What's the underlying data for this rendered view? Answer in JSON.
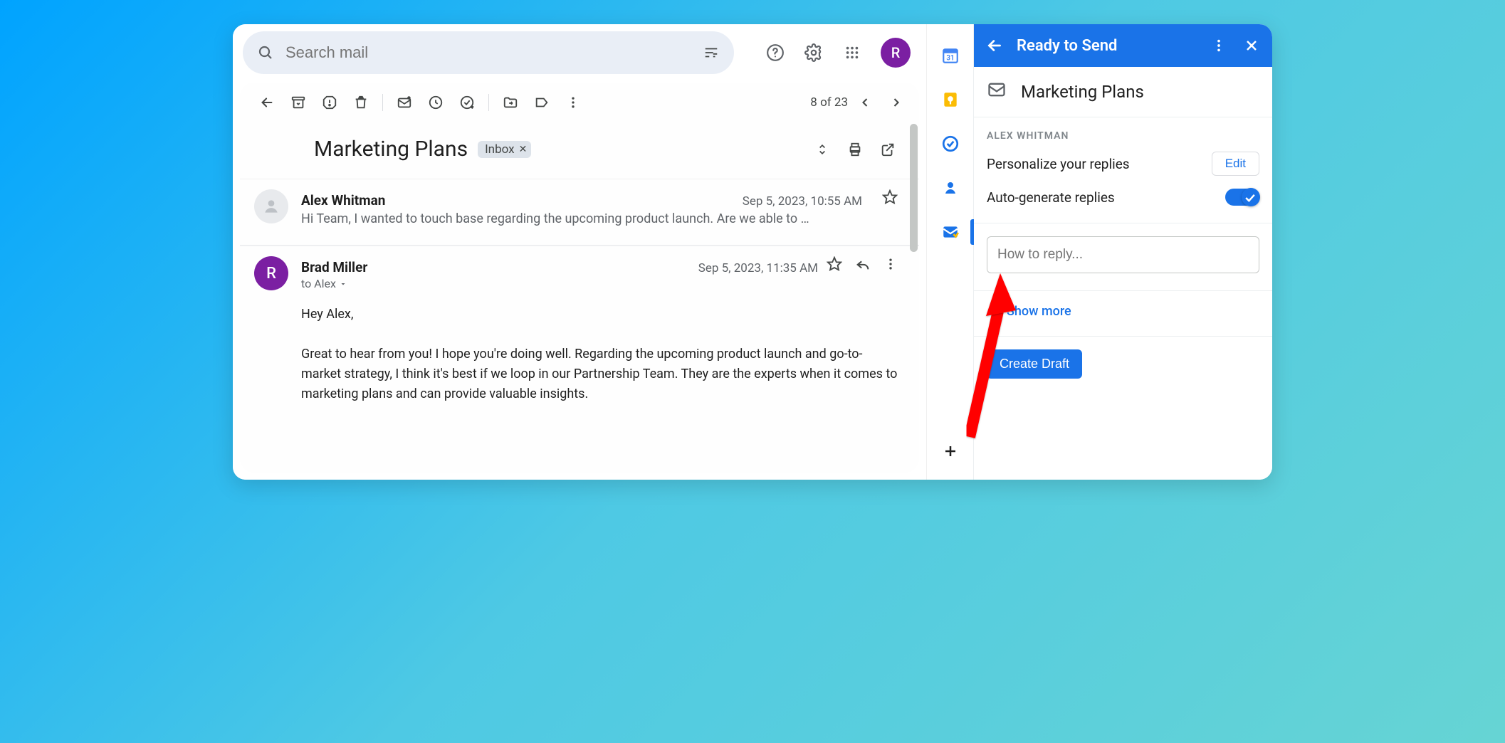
{
  "search": {
    "placeholder": "Search mail"
  },
  "avatar_letter": "R",
  "pager": {
    "label": "8 of 23"
  },
  "subject": "Marketing Plans",
  "subject_chip": "Inbox",
  "messages": {
    "collapsed": {
      "sender": "Alex Whitman",
      "date": "Sep 5, 2023, 10:55 AM",
      "snippet": "Hi Team, I wanted to touch base regarding the upcoming product launch. Are we able to …"
    },
    "expanded": {
      "sender": "Brad Miller",
      "avatar_letter": "R",
      "to_line": "to Alex",
      "date": "Sep 5, 2023, 11:35 AM",
      "greeting": "Hey Alex,",
      "body": "Great to hear from you! I hope you're doing well. Regarding the upcoming product launch and go-to-market strategy, I think it's best if we loop in our Partnership Team. They are the experts when it comes to marketing plans and can provide valuable insights."
    }
  },
  "panel": {
    "title": "Ready to Send",
    "subject": "Marketing Plans",
    "caption": "ALEX WHITMAN",
    "personalize_label": "Personalize your replies",
    "edit_label": "Edit",
    "autogen_label": "Auto-generate replies",
    "reply_placeholder": "How to reply...",
    "show_more": "Show more",
    "create_draft": "Create Draft"
  }
}
